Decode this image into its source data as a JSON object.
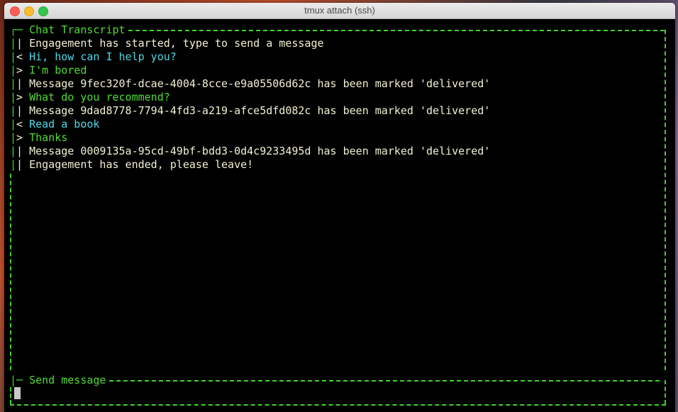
{
  "window": {
    "title": "tmux attach (ssh)",
    "buttons": [
      "close",
      "minimize",
      "maximize"
    ]
  },
  "colors": {
    "border": "#3fd22a",
    "system_text": "#f2f0d4",
    "agent_text": "#4fd8e8",
    "user_text": "#4fdb34",
    "background": "#000000"
  },
  "transcript": {
    "title": "Chat Transcript",
    "lines": [
      {
        "prefix": "|",
        "text": "Engagement has started, type to send a message",
        "kind": "system"
      },
      {
        "prefix": "<",
        "text": "Hi, how can I help you?",
        "kind": "agent"
      },
      {
        "prefix": ">",
        "text": "I'm bored",
        "kind": "user"
      },
      {
        "prefix": "|",
        "text": "Message 9fec320f-dcae-4004-8cce-e9a05506d62c has been marked 'delivered'",
        "kind": "system"
      },
      {
        "prefix": ">",
        "text": "What do you recommend?",
        "kind": "user"
      },
      {
        "prefix": "|",
        "text": "Message 9dad8778-7794-4fd3-a219-afce5dfd082c has been marked 'delivered'",
        "kind": "system"
      },
      {
        "prefix": "<",
        "text": "Read a book",
        "kind": "agent"
      },
      {
        "prefix": ">",
        "text": "Thanks",
        "kind": "user"
      },
      {
        "prefix": "|",
        "text": "Message 0009135a-95cd-49bf-bdd3-0d4c9233495d has been marked 'delivered'",
        "kind": "system"
      },
      {
        "prefix": "|",
        "text": "Engagement has ended, please leave!",
        "kind": "system"
      }
    ]
  },
  "input": {
    "title": "Send message",
    "value": ""
  }
}
